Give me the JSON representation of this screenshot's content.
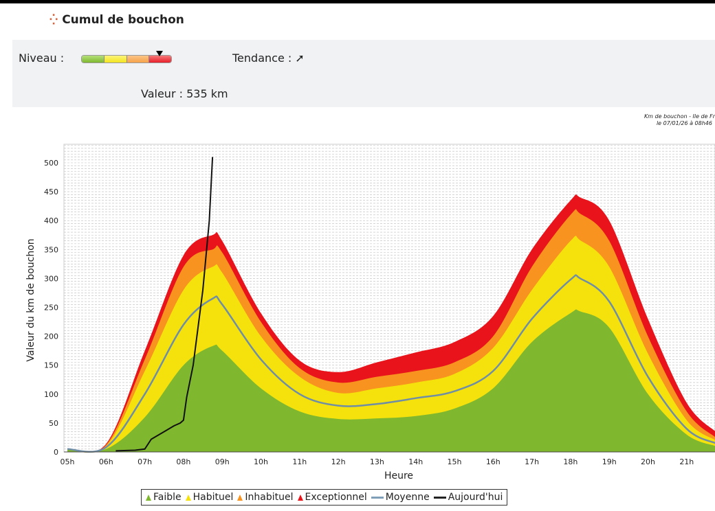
{
  "header": {
    "title": "Cumul de bouchon",
    "icon": "crosshair-arrows-icon"
  },
  "panel": {
    "niveau_label": "Niveau :",
    "tendance_label": "Tendance :",
    "tendance_icon": "arrow-up-right-icon",
    "valeur_label": "Valeur : 535 km"
  },
  "gauge": {
    "colors": [
      "#8cc63f",
      "#f4e520",
      "#f7a24a",
      "#e8202a"
    ],
    "level_fraction": 0.88
  },
  "chart_data": {
    "type": "area",
    "title": "Km de bouchon - Ile de Fr",
    "subtitle": "le 07/01/26 à 08h46",
    "xlabel": "Heure",
    "ylabel": "Valeur du  km de bouchon",
    "xticks": [
      "05h",
      "06h",
      "07h",
      "08h",
      "09h",
      "10h",
      "11h",
      "12h",
      "13h",
      "14h",
      "15h",
      "16h",
      "17h",
      "18h",
      "19h",
      "20h",
      "21h"
    ],
    "yticks": [
      0,
      50,
      100,
      150,
      200,
      250,
      300,
      350,
      400,
      450,
      500
    ],
    "ylim": [
      0,
      530
    ],
    "xlim": [
      "05:00",
      "21:45"
    ],
    "grid": "horizontal dashed",
    "x": [
      "05:00",
      "06:00",
      "07:00",
      "08:00",
      "08:45",
      "09:00",
      "10:00",
      "11:00",
      "12:00",
      "13:00",
      "14:00",
      "15:00",
      "16:00",
      "17:00",
      "18:00",
      "18:15",
      "19:00",
      "20:00",
      "21:00",
      "21:45"
    ],
    "series": [
      {
        "name": "Exceptionnel",
        "color": "#e8131b",
        "values": [
          6,
          14,
          175,
          340,
          375,
          365,
          240,
          158,
          138,
          155,
          172,
          190,
          235,
          350,
          435,
          440,
          400,
          230,
          85,
          35
        ]
      },
      {
        "name": "Inhabituel",
        "color": "#f7931e",
        "values": [
          5,
          12,
          160,
          320,
          350,
          345,
          225,
          145,
          120,
          130,
          140,
          155,
          200,
          320,
          410,
          412,
          365,
          200,
          70,
          25
        ]
      },
      {
        "name": "Habituel",
        "color": "#f5e20c",
        "values": [
          5,
          10,
          140,
          280,
          320,
          310,
          200,
          130,
          102,
          110,
          120,
          135,
          180,
          280,
          365,
          366,
          320,
          170,
          55,
          20
        ]
      },
      {
        "name": "Faible",
        "color": "#7fb82e",
        "values": [
          5,
          5,
          60,
          150,
          183,
          175,
          110,
          70,
          57,
          58,
          62,
          75,
          110,
          190,
          240,
          243,
          215,
          100,
          30,
          10
        ]
      },
      {
        "name": "Moyenne",
        "color": "#7f9fb8",
        "values": [
          5,
          8,
          100,
          220,
          265,
          255,
          160,
          100,
          80,
          83,
          93,
          105,
          140,
          230,
          298,
          300,
          260,
          130,
          40,
          15
        ]
      }
    ],
    "today": {
      "name": "Aujourd'hui",
      "color": "#111111",
      "x": [
        "06:15",
        "06:45",
        "07:00",
        "07:10",
        "07:30",
        "07:45",
        "07:55",
        "08:00",
        "08:05",
        "08:15",
        "08:30",
        "08:40",
        "08:45"
      ],
      "values": [
        2,
        3,
        5,
        22,
        35,
        45,
        50,
        55,
        95,
        150,
        280,
        400,
        510
      ]
    },
    "legend": [
      "Faible",
      "Habituel",
      "Inhabituel",
      "Exceptionnel",
      "Moyenne",
      "Aujourd'hui"
    ]
  }
}
